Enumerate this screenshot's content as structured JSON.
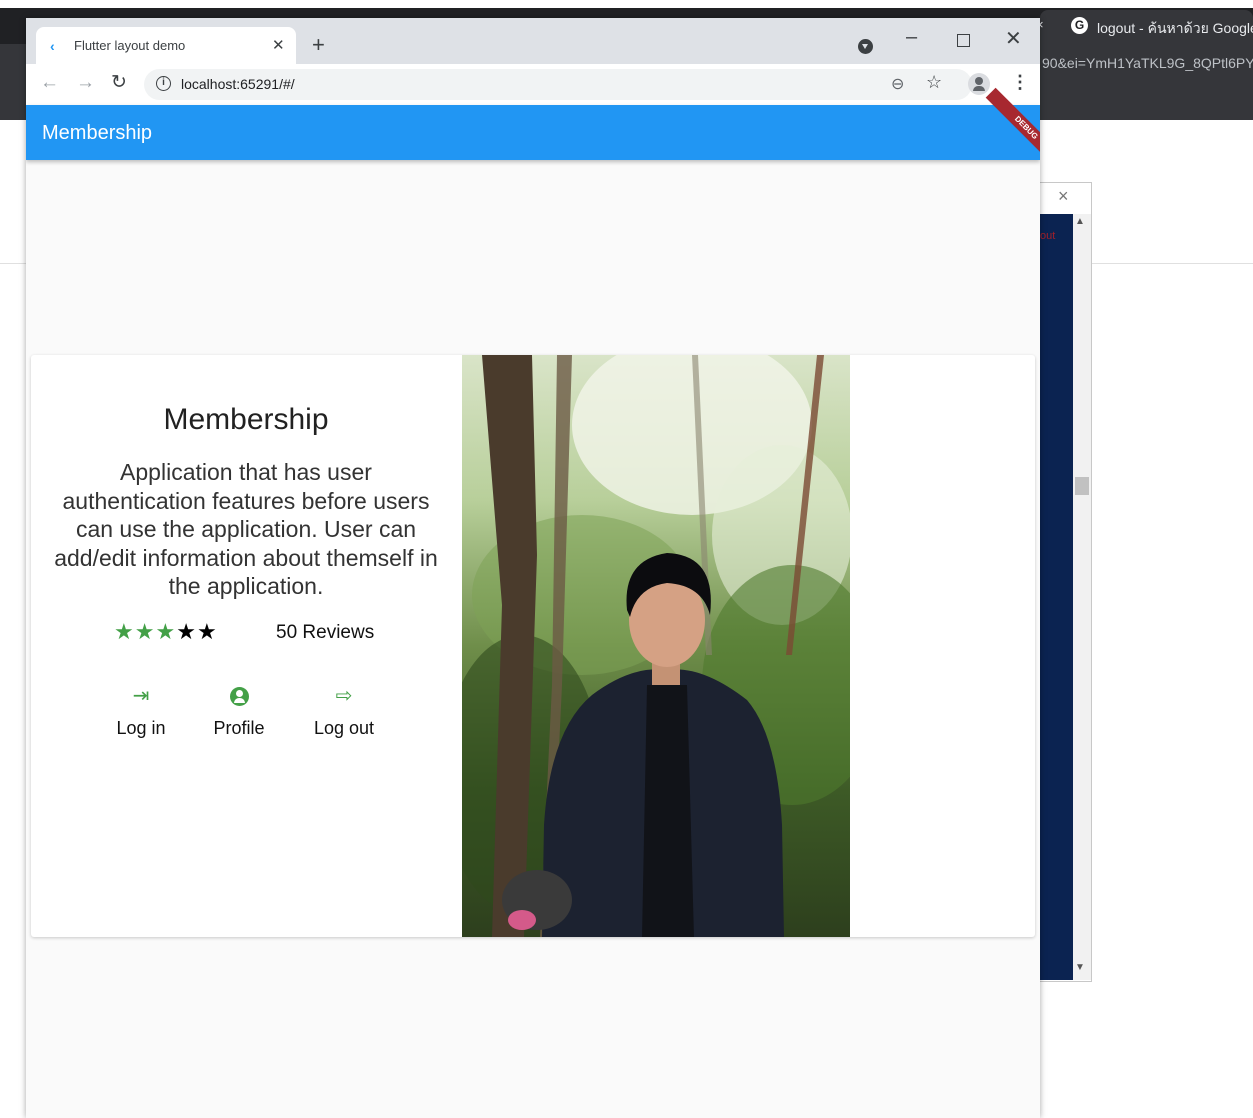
{
  "background": {
    "other_tab_title": "logout - ค้นหาด้วย Google",
    "other_url_fragment": "90&ei=YmH1YaTKL9G_8QPtl6PY",
    "side_text": "out"
  },
  "browser": {
    "tab_title": "Flutter layout demo",
    "url": "localhost:65291/#/"
  },
  "app": {
    "appbar_title": "Membership",
    "debug_label": "DEBUG",
    "card": {
      "title": "Membership",
      "description": "Application that has user authentication features before users can use the application. User can add/edit information about themself in the application.",
      "rating": {
        "stars_filled_green": 3,
        "stars_total": 5,
        "reviews_text": "50 Reviews"
      },
      "actions": [
        {
          "label": "Log in",
          "icon": "login-icon"
        },
        {
          "label": "Profile",
          "icon": "account-circle-icon"
        },
        {
          "label": "Log out",
          "icon": "logout-icon"
        }
      ]
    }
  },
  "colors": {
    "appbar": "#2196f3",
    "accent_green": "#43a047",
    "debug_banner": "#a7282f",
    "tab_bar": "#dee1e6"
  }
}
